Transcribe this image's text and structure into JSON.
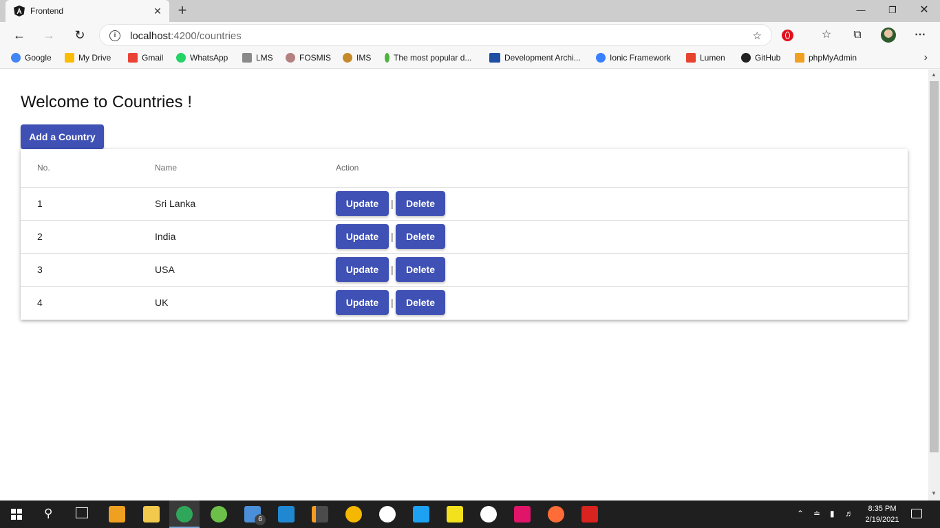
{
  "browser": {
    "tab_title": "Frontend",
    "tab_close": "✕",
    "new_tab": "+",
    "url_host": "localhost",
    "url_path": ":4200/countries",
    "bookmarks": [
      {
        "label": "Google",
        "icon": "google-icon",
        "color": "#4285f4"
      },
      {
        "label": "My Drive",
        "icon": "drive-icon",
        "color": "#fbbc04"
      },
      {
        "label": "Gmail",
        "icon": "gmail-icon",
        "color": "#ea4335"
      },
      {
        "label": "WhatsApp",
        "icon": "whatsapp-icon",
        "color": "#25d366"
      },
      {
        "label": "LMS",
        "icon": "lms-icon",
        "color": "#8a8a8a"
      },
      {
        "label": "FOSMIS",
        "icon": "fosmis-icon",
        "color": "#b58080"
      },
      {
        "label": "IMS",
        "icon": "ims-icon",
        "color": "#c58a2a"
      },
      {
        "label": "The most popular d...",
        "icon": "mongodb-icon",
        "color": "#4db33d"
      },
      {
        "label": "Development Archi...",
        "icon": "freedownload-icon",
        "color": "#1e4fa3"
      },
      {
        "label": "Ionic Framework",
        "icon": "ionic-icon",
        "color": "#3880ff"
      },
      {
        "label": "Lumen",
        "icon": "lumen-icon",
        "color": "#e74430"
      },
      {
        "label": "GitHub",
        "icon": "github-icon",
        "color": "#222222"
      },
      {
        "label": "phpMyAdmin",
        "icon": "phpmyadmin-icon",
        "color": "#f0a020"
      }
    ]
  },
  "page": {
    "title": "Welcome to Countries !",
    "add_button": "Add a Country",
    "columns": {
      "no": "No.",
      "name": "Name",
      "action": "Action"
    },
    "update_label": "Update",
    "delete_label": "Delete",
    "separator": "|",
    "rows": [
      {
        "no": "1",
        "name": "Sri Lanka"
      },
      {
        "no": "2",
        "name": "India"
      },
      {
        "no": "3",
        "name": "USA"
      },
      {
        "no": "4",
        "name": "UK"
      }
    ],
    "accent_color": "#3f51b5"
  },
  "taskbar": {
    "mail_badge": "6",
    "time": "8:35 PM",
    "date": "2/19/2021"
  }
}
